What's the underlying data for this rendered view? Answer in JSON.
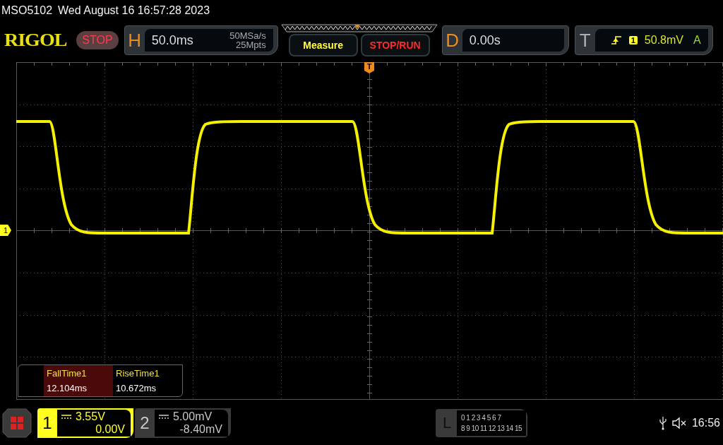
{
  "title_bar": {
    "model": "MSO5102",
    "datetime": "Wed August 16 16:57:28 2023"
  },
  "logo": "RIGOL",
  "run_state": {
    "label": "STOP",
    "kind": "stop"
  },
  "horizontal": {
    "label": "H",
    "timebase": "50.0ms",
    "sample_rate": "50MSa/s",
    "memory_depth": "25Mpts"
  },
  "buttons": [
    {
      "label": "Measure",
      "kind": "measure"
    },
    {
      "label": "STOP/RUN",
      "kind": "stoprun"
    }
  ],
  "delay": {
    "label": "D",
    "value": "0.00s"
  },
  "trigger": {
    "label": "T",
    "source": "1",
    "level": "50.8mV",
    "mode": "A"
  },
  "waveform": {
    "channel_marker": "1",
    "trigger_marker": "T"
  },
  "measurements": [
    {
      "name": "FallTime1",
      "value": "12.104ms",
      "highlighted": true
    },
    {
      "name": "RiseTime1",
      "value": "10.672ms",
      "highlighted": false
    }
  ],
  "channels": [
    {
      "number": "1",
      "scale": "3.55V",
      "offset": "0.00V",
      "selected": true
    },
    {
      "number": "2",
      "scale": "5.00mV",
      "offset": "-8.40mV",
      "selected": false
    }
  ],
  "logic": {
    "label": "L",
    "rows": [
      "0 1 2 3 4 5 6 7",
      "8 9 10 11 12 13 14 15"
    ]
  },
  "status": {
    "time": "16:56"
  }
}
